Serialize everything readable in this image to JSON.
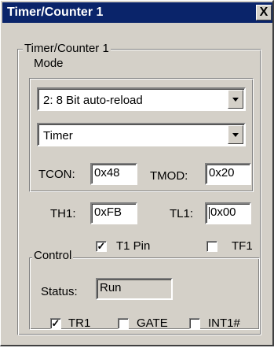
{
  "window": {
    "title": "Timer/Counter 1",
    "close_label": "X"
  },
  "group": {
    "label": "Timer/Counter 1"
  },
  "mode": {
    "label": "Mode",
    "mode_select": {
      "value": "2: 8 Bit auto-reload"
    },
    "type_select": {
      "value": "Timer"
    }
  },
  "registers": {
    "tcon_label": "TCON:",
    "tcon_value": "0x48",
    "tmod_label": "TMOD:",
    "tmod_value": "0x20",
    "th1_label": "TH1:",
    "th1_value": "0xFB",
    "tl1_label": "TL1:",
    "tl1_value": "0x00"
  },
  "pins": {
    "t1pin_label": "T1 Pin",
    "t1pin_checked": true,
    "t1pin_mark": "✓",
    "tf1_label": "TF1",
    "tf1_checked": false
  },
  "control": {
    "label": "Control",
    "status_label": "Status:",
    "status_value": "Run",
    "tr1_label": "TR1",
    "tr1_checked": true,
    "tr1_mark": "✓",
    "gate_label": "GATE",
    "gate_checked": false,
    "int1_label": "INT1#",
    "int1_checked": false
  },
  "colors": {
    "titlebar": "#0a246a",
    "face": "#d4d0c8"
  }
}
